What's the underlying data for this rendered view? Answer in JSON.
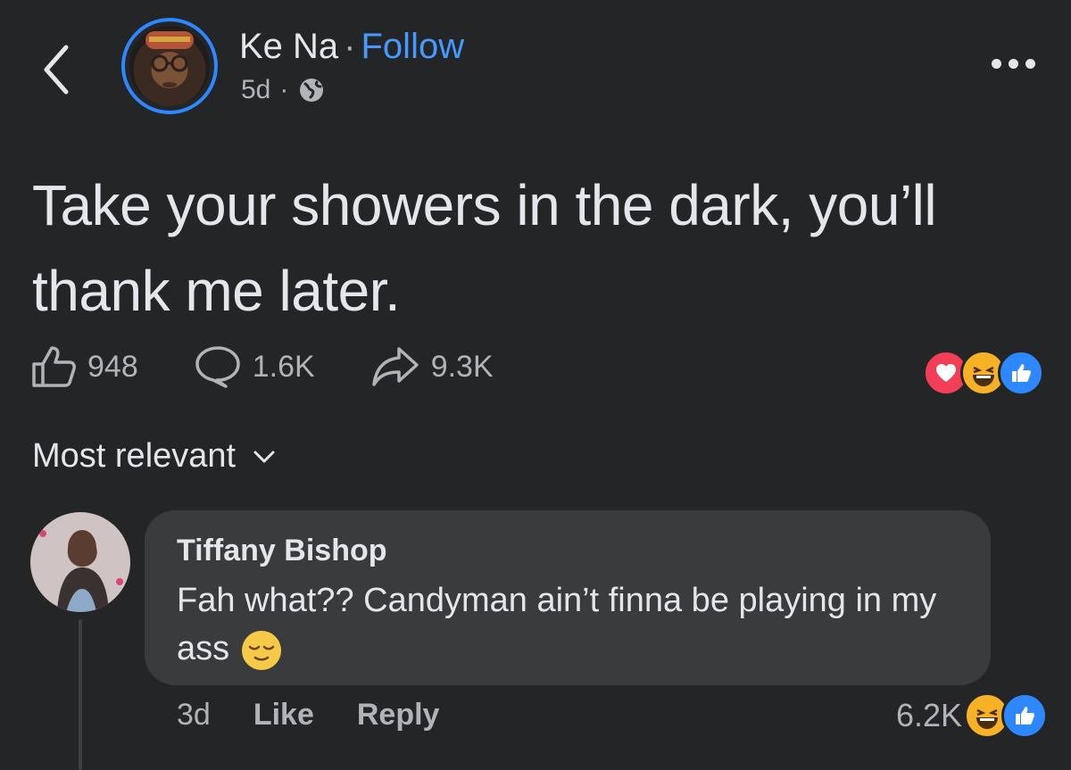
{
  "header": {
    "back_icon": "chevron-left-icon",
    "author_name": "Ke Na",
    "separator": "·",
    "follow_label": "Follow",
    "time_ago": "5d",
    "meta_separator": "·",
    "privacy_icon": "globe-icon",
    "more_icon": "more-horizontal-icon"
  },
  "post": {
    "text": "Take your showers in the dark, you’ll thank me later."
  },
  "stats": {
    "likes": "948",
    "comments": "1.6K",
    "shares": "9.3K",
    "reactions": [
      "love",
      "haha",
      "like"
    ]
  },
  "sort": {
    "label": "Most relevant"
  },
  "comment": {
    "author": "Tiffany Bishop",
    "text": "Fah what?? Candyman ain’t finna be playing in my ass",
    "emoji": "relieved-face",
    "time_ago": "3d",
    "like_label": "Like",
    "reply_label": "Reply",
    "reaction_count": "6.2K",
    "reactions": [
      "haha",
      "like"
    ]
  },
  "colors": {
    "background": "#242526",
    "accent": "#4599ff",
    "bubble": "#3a3b3c",
    "love": "#f33e58",
    "haha": "#f7b125",
    "like": "#2d88ff"
  }
}
